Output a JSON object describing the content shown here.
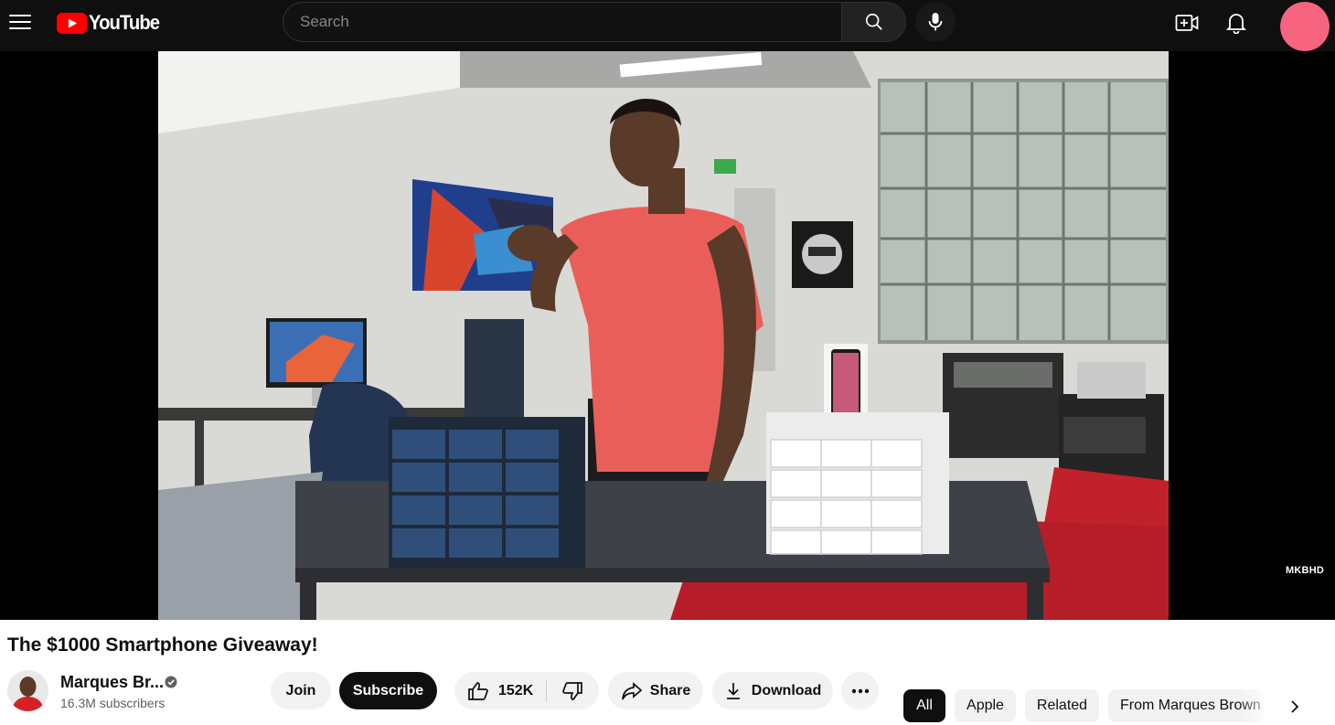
{
  "header": {
    "logo_text": "YouTube",
    "search_placeholder": "Search",
    "icons": [
      "menu-icon",
      "search-icon",
      "mic-icon",
      "create-video-icon",
      "bell-icon"
    ],
    "avatar_color": "#f76480"
  },
  "player": {
    "watermark": "MKBHD",
    "background": "#000000"
  },
  "video": {
    "title": "The $1000 Smartphone Giveaway!"
  },
  "channel": {
    "name": "Marques Br...",
    "subscribers": "16.3M subscribers",
    "verified_icon": "verified-check-icon"
  },
  "actions": {
    "join": "Join",
    "subscribe": "Subscribe",
    "likes": "152K",
    "share": "Share",
    "download": "Download"
  },
  "chips": {
    "all": "All",
    "apple": "Apple",
    "related": "Related",
    "from": "From Marques Brown"
  },
  "colors": {
    "brand_red": "#ff0000",
    "header_bg": "#0f0f0f",
    "pill_bg": "#f2f2f2",
    "subscribe_bg": "#0f0f0f"
  }
}
